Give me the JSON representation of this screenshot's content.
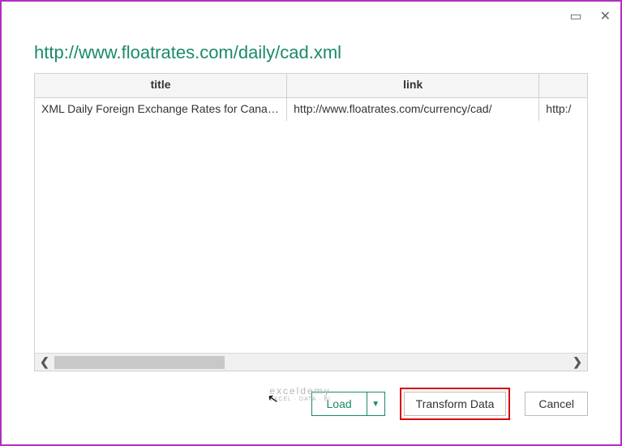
{
  "window": {
    "maximize_glyph": "▭",
    "close_glyph": "✕"
  },
  "header": {
    "url": "http://www.floatrates.com/daily/cad.xml"
  },
  "table": {
    "columns": {
      "c0": "title",
      "c1": "link",
      "c2": ""
    },
    "rows": [
      {
        "title": "XML Daily Foreign Exchange Rates for Canadian Dollar (...",
        "link": "http://www.floatrates.com/currency/cad/",
        "extra": "http:/"
      }
    ]
  },
  "scroll": {
    "left_glyph": "❮",
    "right_glyph": "❯"
  },
  "footer": {
    "load": "Load",
    "caret": "▼",
    "transform": "Transform Data",
    "cancel": "Cancel"
  },
  "watermark": {
    "main": "exceldemy",
    "sub": "EXCEL · DATA · BI"
  },
  "cursor_glyph": "➤"
}
